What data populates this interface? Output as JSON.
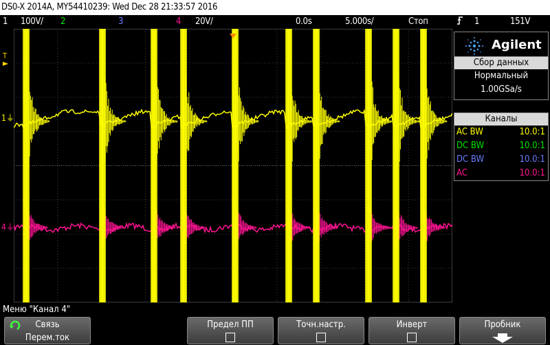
{
  "title_bar": "DS0-X 2014A, MY54410239: Wed Dec 28 21:33:57 2016",
  "status": {
    "ch1_num": "1",
    "ch1_scale": "100V/",
    "ch2_num": "2",
    "ch3_num": "3",
    "ch4_num": "4",
    "ch4_scale": "20V/",
    "delay": "0.0s",
    "timebase": "5.000s/",
    "run_state": "Стоп",
    "trigger_source": "1",
    "trigger_level": "151V"
  },
  "ch1_marker": "1",
  "ch4_marker": "4",
  "trigger_marker": "T",
  "brand": "Agilent",
  "acquisition": {
    "header": "Сбор данных",
    "mode": "Нормальный",
    "rate": "1.00GSa/s"
  },
  "channels": {
    "header": "Каналы",
    "rows": [
      {
        "label": "AC BW",
        "ratio": "10.0:1",
        "color": "#ffff00"
      },
      {
        "label": "DC BW",
        "ratio": "10.0:1",
        "color": "#00e600"
      },
      {
        "label": "DC BW",
        "ratio": "10.0:1",
        "color": "#6a7cff"
      },
      {
        "label": "AC",
        "ratio": "10.0:1",
        "color": "#ff1493"
      }
    ]
  },
  "menu_title": "Меню \"Канал 4\"",
  "softkeys": {
    "coupling_label": "Связь",
    "coupling_value": "Перем.ток",
    "bw_limit_label": "Предел ПП",
    "fine_label": "Точн.настр.",
    "invert_label": "Инверт",
    "probe_label": "Пробник"
  },
  "colors": {
    "ch1": "#ffff00",
    "ch2": "#00e600",
    "ch3": "#6a7cff",
    "ch4": "#ff1493",
    "trigger": "#ff8c00"
  },
  "icons": [
    "rotary-knob-icon",
    "trigger-edge-icon",
    "probe-down-arrow-icon",
    "agilent-logo-icon"
  ]
}
